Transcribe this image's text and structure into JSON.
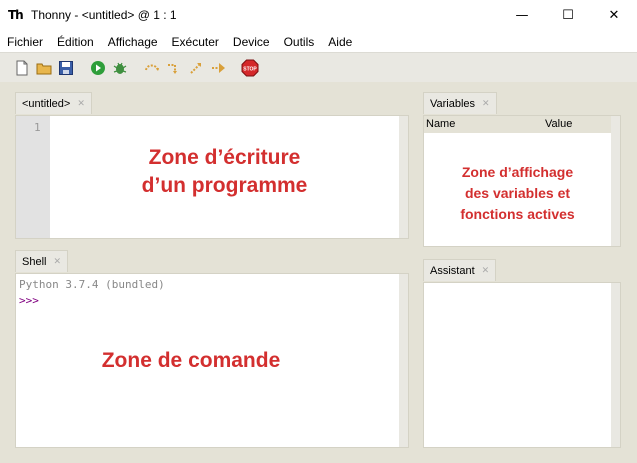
{
  "window": {
    "title": "Thonny  -  <untitled>  @  1 : 1",
    "app_icon_text": "Th",
    "controls": {
      "minimize": "—",
      "maximize": "☐",
      "close": "✕"
    }
  },
  "menu": [
    "Fichier",
    "Édition",
    "Affichage",
    "Exécuter",
    "Device",
    "Outils",
    "Aide"
  ],
  "toolbar": {
    "buttons": [
      "new-file-icon",
      "open-file-icon",
      "save-icon",
      "run-icon",
      "debug-icon",
      "step-over-icon",
      "step-into-icon",
      "step-out-icon",
      "resume-icon",
      "stop-icon"
    ],
    "stop_label": "STOP"
  },
  "editor": {
    "tab_label": "<untitled>",
    "line_numbers": [
      "1"
    ],
    "overlay_line1": "Zone d’écriture",
    "overlay_line2": "d’un programme"
  },
  "shell": {
    "tab_label": "Shell",
    "banner": "Python 3.7.4 (bundled)",
    "prompt": ">>>",
    "overlay": "Zone de comande"
  },
  "variables": {
    "tab_label": "Variables",
    "col_name": "Name",
    "col_value": "Value",
    "overlay_line1": "Zone d’affichage",
    "overlay_line2": "des variables et",
    "overlay_line3": "fonctions actives"
  },
  "assistant": {
    "tab_label": "Assistant"
  },
  "colors": {
    "annotation": "#d32f2f",
    "prompt": "#800080",
    "banner": "#888888",
    "workspace": "#e4e2d6"
  }
}
